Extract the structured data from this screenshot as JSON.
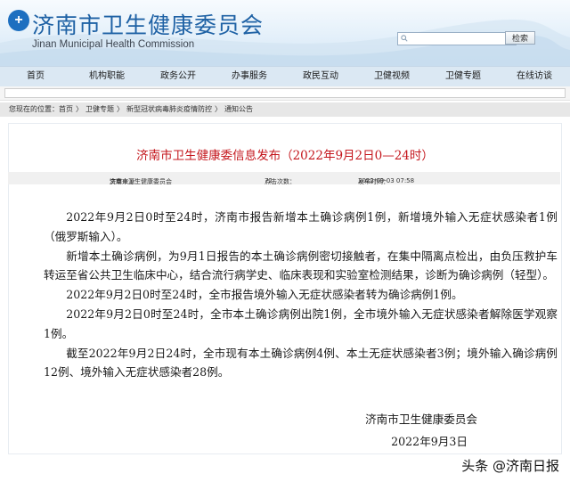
{
  "header": {
    "title": "济南市卫生健康委员会",
    "subtitle": "Jinan Municipal Health Commission",
    "search_button": "检索",
    "brand_color": "#1f62a5"
  },
  "nav": {
    "items": [
      "首页",
      "机构职能",
      "政务公开",
      "办事服务",
      "政民互动",
      "卫健视频",
      "卫健专题",
      "在线访谈"
    ]
  },
  "breadcrumb": {
    "prefix": "您现在的位置：",
    "items": [
      "首页",
      "卫健专题",
      "新型冠状病毒肺炎疫情防控",
      "通知公告"
    ]
  },
  "article": {
    "title": "济南市卫生健康委信息发布（2022年9月2日0—24时）",
    "title_color": "#c4161c",
    "source_label": "文章来源：",
    "source": "济南市卫生健康委员会",
    "clicks_label": "点击次数：",
    "clicks": "72",
    "date_label": "发布时间：",
    "date": "2022-09-03 07:58",
    "paragraphs": [
      "2022年9月2日0时至24时，济南市报告新增本土确诊病例1例，新增境外输入无症状感染者1例（俄罗斯输入）。",
      "新增本土确诊病例，为9月1日报告的本土确诊病例密切接触者，在集中隔离点检出，由负压救护车转运至省公共卫生临床中心，结合流行病学史、临床表现和实验室检测结果，诊断为确诊病例（轻型）。",
      "2022年9月2日0时至24时，全市报告境外输入无症状感染者转为确诊病例1例。",
      "2022年9月2日0时至24时，全市本土确诊病例出院1例，全市境外输入无症状感染者解除医学观察1例。",
      "截至2022年9月2日24时，全市现有本土确诊病例4例、本土无症状感染者3例；境外输入确诊病例12例、境外输入无症状感染者28例。"
    ],
    "signature": "济南市卫生健康委员会",
    "signature_date": "2022年9月3日"
  },
  "watermark": "头条 @济南日报"
}
